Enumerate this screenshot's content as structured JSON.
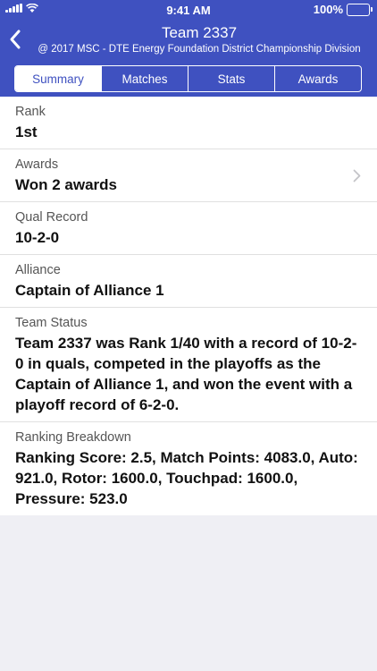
{
  "status_bar": {
    "time": "9:41 AM",
    "battery": "100%"
  },
  "header": {
    "title": "Team 2337",
    "subtitle": "@ 2017 MSC - DTE Energy Foundation District Championship Division"
  },
  "tabs": [
    {
      "label": "Summary",
      "active": true
    },
    {
      "label": "Matches",
      "active": false
    },
    {
      "label": "Stats",
      "active": false
    },
    {
      "label": "Awards",
      "active": false
    }
  ],
  "rows": [
    {
      "label": "Rank",
      "value": "1st"
    },
    {
      "label": "Awards",
      "value": "Won 2 awards"
    },
    {
      "label": "Qual Record",
      "value": "10-2-0"
    },
    {
      "label": "Alliance",
      "value": "Captain of Alliance 1"
    },
    {
      "label": "Team Status",
      "value": "Team 2337 was Rank 1/40 with a record of 10-2-0 in quals, competed in the playoffs as the Captain of Alliance 1, and won the event with a playoff record of 6-2-0."
    },
    {
      "label": "Ranking Breakdown",
      "value": "Ranking Score: 2.5, Match Points: 4083.0, Auto: 921.0, Rotor: 1600.0, Touchpad: 1600.0, Pressure: 523.0"
    }
  ],
  "colors": {
    "brand": "#3f51c0"
  },
  "icons": {
    "back": "chevron-left-icon",
    "disclosure": "chevron-right-icon"
  }
}
